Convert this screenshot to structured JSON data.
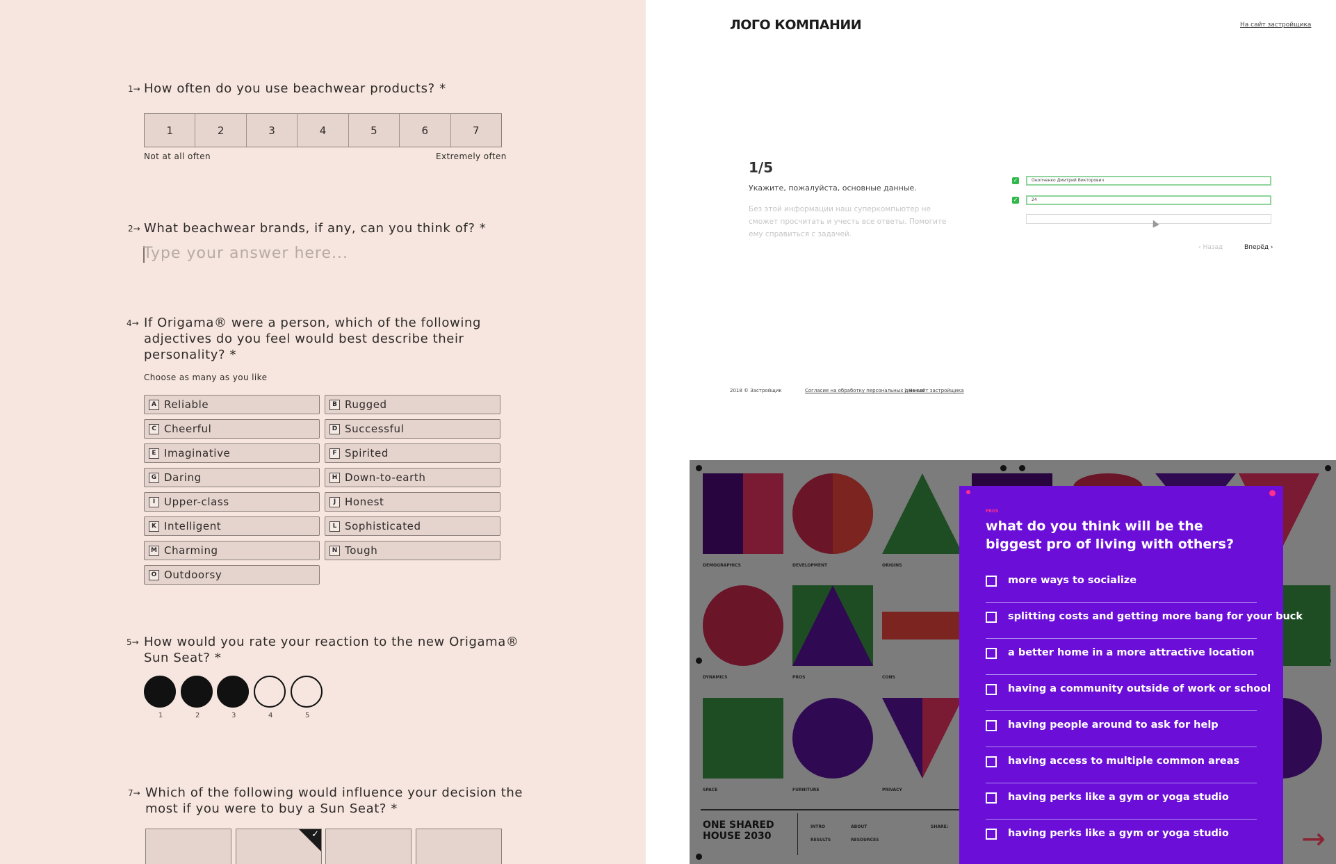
{
  "left": {
    "q1": {
      "num": "1→",
      "text": "How often do you use beachwear products? *",
      "scale": [
        "1",
        "2",
        "3",
        "4",
        "5",
        "6",
        "7"
      ],
      "low": "Not at all often",
      "high": "Extremely often"
    },
    "q2": {
      "num": "2→",
      "text": "What beachwear brands, if any, can you think of? *",
      "placeholder": "Type your answer here..."
    },
    "q4": {
      "num": "4→",
      "line1": "If Origama® were a person, which of the following",
      "line2": "adjectives do you feel would best describe their",
      "line3": "personality? *",
      "hint": "Choose as many as you like",
      "options": [
        {
          "key": "A",
          "label": "Reliable"
        },
        {
          "key": "B",
          "label": "Rugged"
        },
        {
          "key": "C",
          "label": "Cheerful"
        },
        {
          "key": "D",
          "label": "Successful"
        },
        {
          "key": "E",
          "label": "Imaginative"
        },
        {
          "key": "F",
          "label": "Spirited"
        },
        {
          "key": "G",
          "label": "Daring"
        },
        {
          "key": "H",
          "label": "Down-to-earth"
        },
        {
          "key": "I",
          "label": "Upper-class"
        },
        {
          "key": "J",
          "label": "Honest"
        },
        {
          "key": "K",
          "label": "Intelligent"
        },
        {
          "key": "L",
          "label": "Sophisticated"
        },
        {
          "key": "M",
          "label": "Charming"
        },
        {
          "key": "N",
          "label": "Tough"
        },
        {
          "key": "O",
          "label": "Outdoorsy"
        }
      ]
    },
    "q5": {
      "num": "5→",
      "line1": "How would you rate your reaction to the new Origama®",
      "line2": "Sun Seat? *",
      "labels": [
        "1",
        "2",
        "3",
        "4",
        "5"
      ],
      "value": 3
    },
    "q7": {
      "num": "7→",
      "line1": "Which of the following would influence your decision the",
      "line2": "most if you were to buy a Sun Seat? *",
      "selected_index": 1
    }
  },
  "rtop": {
    "logo": "ЛОГО КОМПАНИИ",
    "link_top": "На сайт застройщика",
    "step": "1/5",
    "intro": "Укажите, пожалуйста, основные данные.",
    "faint": "Без этой информации наш суперкомпьютер не сможет просчитать и учесть все ответы. Помогите ему справиться с задачей.",
    "field1": "Онопченко Дмитрий Викторович",
    "field2": "24",
    "back": "‹ Назад",
    "next": "Вперёд ›",
    "footer_copy": "2018 © Застройщик",
    "footer_link1": "Согласие на обработку персональных данных",
    "footer_sep": "|",
    "footer_link2": "На сайт застройщика"
  },
  "rbot": {
    "labels": [
      "DEMOGRAPHICS",
      "DEVELOPMENT",
      "ORIGINS",
      "DYNAMICS",
      "PROS",
      "CONS",
      "SPACE",
      "FURNITURE",
      "PRIVACY"
    ],
    "brand1": "ONE SHARED",
    "brand2": "HOUSE 2030",
    "nav": {
      "intro": "INTRO",
      "about": "ABOUT",
      "results": "RESULTS",
      "resources": "RESOURCES",
      "share": "SHARE:"
    },
    "panel": {
      "tag": "PROS",
      "question": "what do you think will be the biggest pro of living with others?",
      "items": [
        "more ways to socialize",
        "splitting costs and getting more bang for your buck",
        "a better home in a more attractive location",
        "having a community outside of work or school",
        "having people around to ask for help",
        "having access to multiple common areas",
        "having perks like a gym or yoga studio",
        "having perks like a gym or yoga studio"
      ]
    },
    "arrow": "→"
  }
}
